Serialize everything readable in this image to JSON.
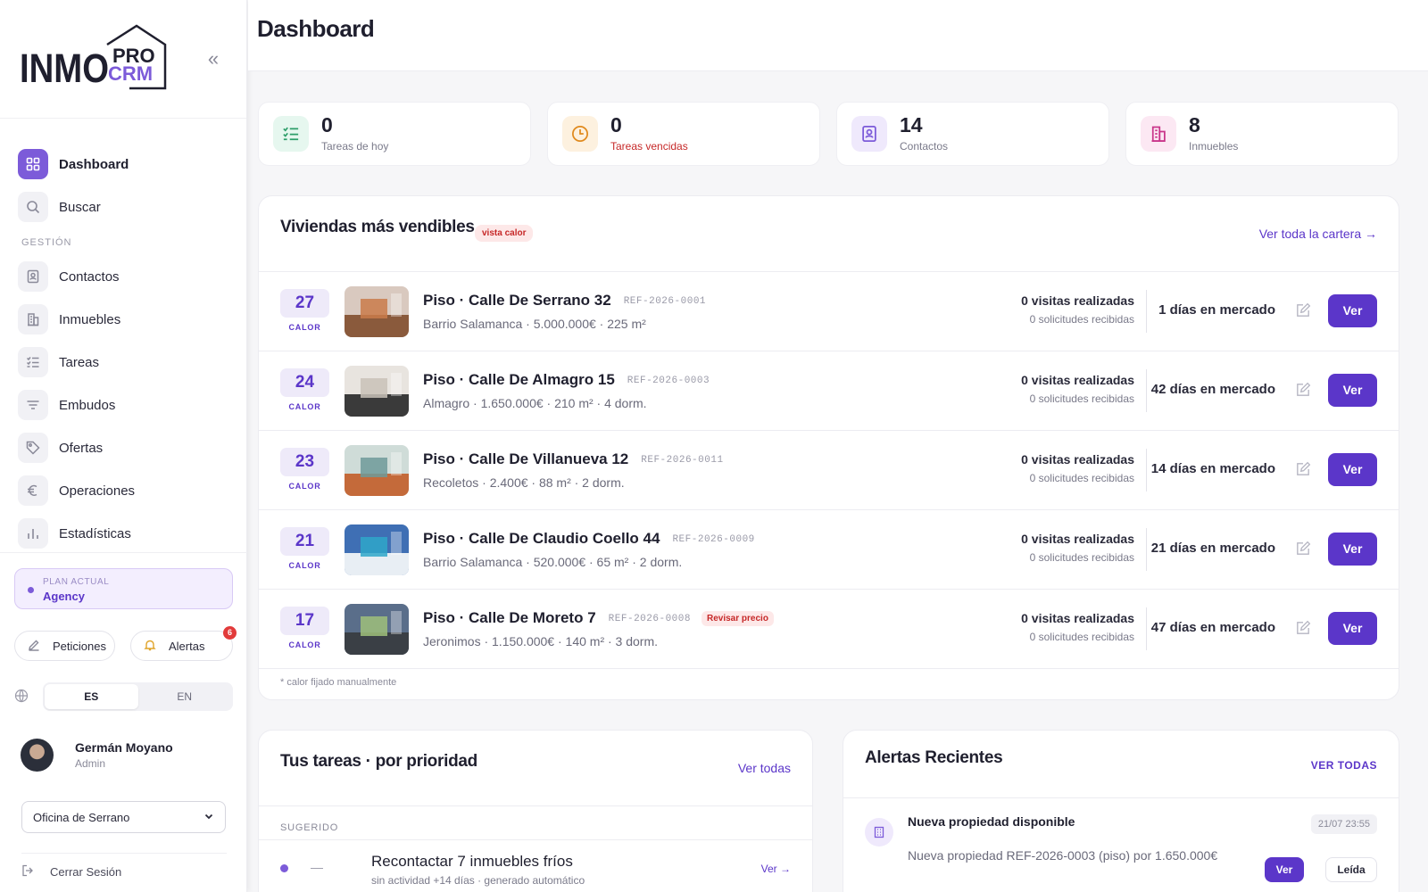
{
  "sidebar": {
    "logo": {
      "inmo": "INMO",
      "pro": "PRO",
      "crm": "CRM"
    },
    "collapse_icon": "double-chevron-left-icon",
    "items_top": [
      {
        "label": "Dashboard",
        "icon": "grid-icon"
      },
      {
        "label": "Buscar",
        "icon": "search-icon"
      }
    ],
    "section_label": "GESTIÓN",
    "items": [
      {
        "label": "Contactos",
        "icon": "contacts-icon"
      },
      {
        "label": "Inmuebles",
        "icon": "building-icon"
      },
      {
        "label": "Tareas",
        "icon": "checklist-icon"
      },
      {
        "label": "Embudos",
        "icon": "filter-icon"
      },
      {
        "label": "Ofertas",
        "icon": "tag-icon"
      },
      {
        "label": "Operaciones",
        "icon": "euro-icon"
      },
      {
        "label": "Estadísticas",
        "icon": "bar-chart-icon"
      }
    ],
    "plan": {
      "small": "PLAN ACTUAL",
      "name": "Agency"
    },
    "peticiones": "Peticiones",
    "alertas": "Alertas",
    "alertas_count": "6",
    "lang": [
      "ES",
      "EN"
    ],
    "user": {
      "name": "Germán Moyano",
      "role": "Admin"
    },
    "office": "Oficina de Serrano",
    "logout": "Cerrar Sesión"
  },
  "header": {
    "title": "Dashboard"
  },
  "stats": [
    {
      "value": "0",
      "label": "Tareas de hoy",
      "icon": "checklist-icon",
      "bg": "#e6f7ef",
      "fg": "#2e9e6a",
      "label_color": "#7a7a8a"
    },
    {
      "value": "0",
      "label": "Tareas vencidas",
      "icon": "clock-icon",
      "bg": "#fdf1df",
      "fg": "#e08a1e",
      "label_color": "#c62828"
    },
    {
      "value": "14",
      "label": "Contactos",
      "icon": "contacts-icon",
      "bg": "#efe9fc",
      "fg": "#7c5bd9",
      "label_color": "#7a7a8a"
    },
    {
      "value": "8",
      "label": "Inmuebles",
      "icon": "building-icon",
      "bg": "#fce8f3",
      "fg": "#c9358a",
      "label_color": "#7a7a8a"
    }
  ],
  "viviendas": {
    "title": "Viviendas más vendibles",
    "tag": "vista calor",
    "link": "Ver toda la cartera →",
    "heat_label": "CALOR",
    "ver": "Ver",
    "rows": [
      {
        "heat": "27",
        "title": "Piso · Calle De Serrano 32",
        "ref": "REF-2026-0001",
        "warn": "",
        "sub": "Barrio Salamanca · 5.000.000€ · 225 m²",
        "visits": "0 visitas realizadas",
        "requests": "0 solicitudes recibidas",
        "days": "1 días en mercado",
        "thumb": [
          "#d9c9bf",
          "#8a5a3c",
          "#c97b4a"
        ]
      },
      {
        "heat": "24",
        "title": "Piso · Calle De Almagro 15",
        "ref": "REF-2026-0003",
        "warn": "",
        "sub": "Almagro · 1.650.000€ · 210 m² · 4 dorm.",
        "visits": "0 visitas realizadas",
        "requests": "0 solicitudes recibidas",
        "days": "42 días en mercado",
        "thumb": [
          "#e8e4df",
          "#3a3a3a",
          "#c9c2b8"
        ]
      },
      {
        "heat": "23",
        "title": "Piso · Calle De Villanueva 12",
        "ref": "REF-2026-0011",
        "warn": "",
        "sub": "Recoletos · 2.400€ · 88 m² · 2 dorm.",
        "visits": "0 visitas realizadas",
        "requests": "0 solicitudes recibidas",
        "days": "14 días en mercado",
        "thumb": [
          "#cfdcd8",
          "#c46a3a",
          "#6f9a9a"
        ]
      },
      {
        "heat": "21",
        "title": "Piso · Calle De Claudio Coello 44",
        "ref": "REF-2026-0009",
        "warn": "",
        "sub": "Barrio Salamanca · 520.000€ · 65 m² · 2 dorm.",
        "visits": "0 visitas realizadas",
        "requests": "0 solicitudes recibidas",
        "days": "21 días en mercado",
        "thumb": [
          "#3f6fb4",
          "#e8eef4",
          "#2fa7c9"
        ]
      },
      {
        "heat": "17",
        "title": "Piso · Calle De Moreto 7",
        "ref": "REF-2026-0008",
        "warn": "Revisar precio",
        "sub": "Jeronimos · 1.150.000€ · 140 m² · 3 dorm.",
        "visits": "0 visitas realizadas",
        "requests": "0 solicitudes recibidas",
        "days": "47 días en mercado",
        "thumb": [
          "#5a6e8a",
          "#3a3f45",
          "#9fbf7a"
        ]
      }
    ],
    "note": "* calor fijado manualmente"
  },
  "tareas": {
    "title": "Tus tareas · por prioridad",
    "link": "Ver todas",
    "section": "SUGERIDO",
    "task": "Recontactar 7 inmuebles fríos",
    "task_sub": "sin actividad +14 días · generado automático",
    "task_dash": "—",
    "task_link": "Ver →"
  },
  "alertas": {
    "title": "Alertas Recientes",
    "link": "VER TODAS",
    "item": {
      "name": "Nueva propiedad disponible",
      "time": "21/07 23:55",
      "desc": "Nueva propiedad REF-2026-0003 (piso) por 1.650.000€",
      "ver": "Ver",
      "leida": "Leída"
    }
  }
}
